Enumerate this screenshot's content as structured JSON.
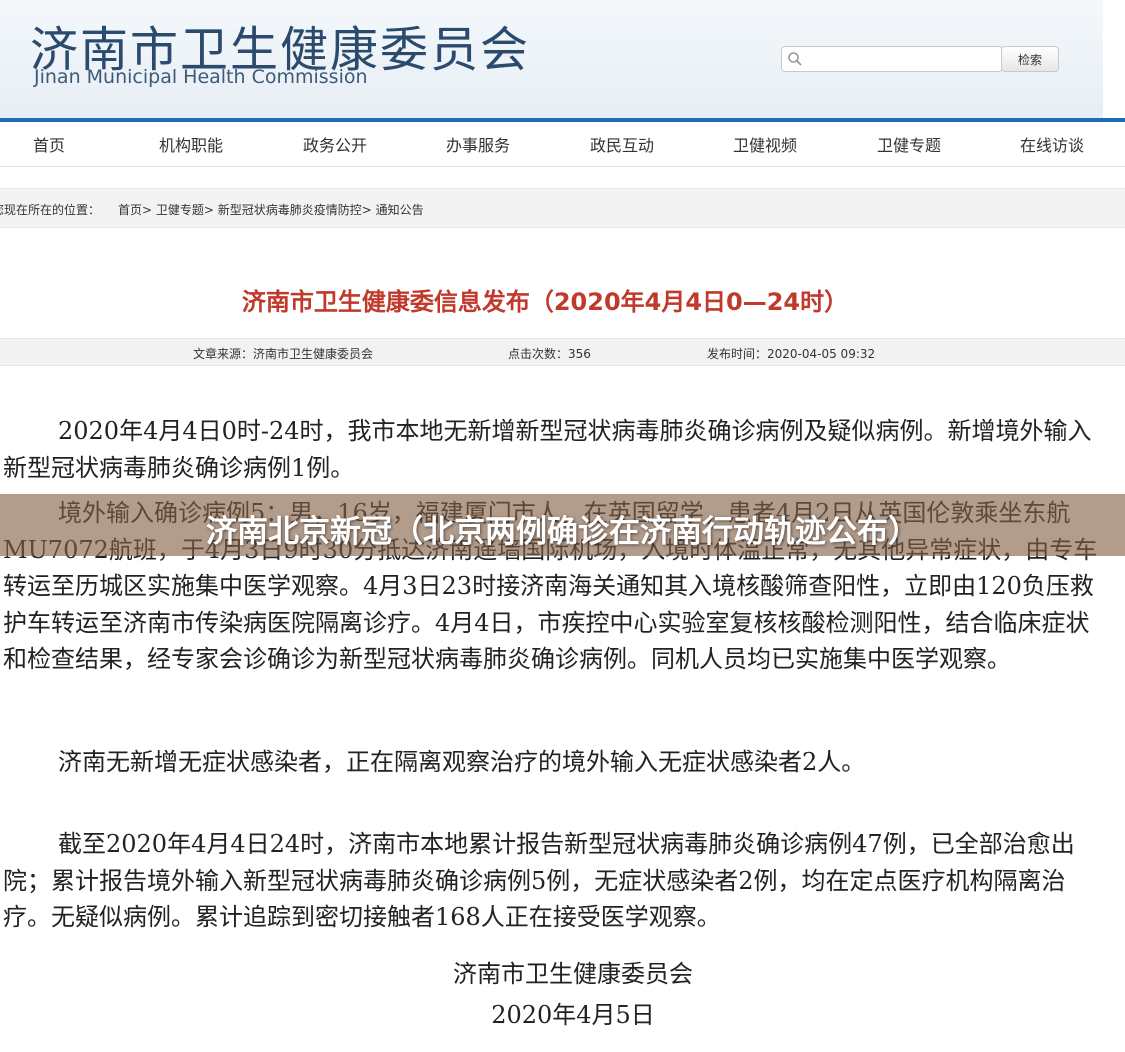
{
  "header": {
    "title_cn": "济南市卫生健康委员会",
    "title_en": "Jinan Municipal Health Commission",
    "search_button": "检索"
  },
  "nav": {
    "items": [
      "首页",
      "机构职能",
      "政务公开",
      "办事服务",
      "政民互动",
      "卫健视频",
      "卫健专题",
      "在线访谈"
    ]
  },
  "breadcrumb": {
    "prefix": "您现在所在的位置：",
    "path": "首页> 卫健专题> 新型冠状病毒肺炎疫情防控> 通知公告"
  },
  "article": {
    "title": "济南市卫生健康委信息发布（2020年4月4日0—24时）",
    "source": "文章来源：济南市卫生健康委员会",
    "clicks": "点击次数：356",
    "publish_time": "发布时间：2020-04-05 09:32",
    "paragraphs": [
      "2020年4月4日0时-24时，我市本地无新增新型冠状病毒肺炎确诊病例及疑似病例。新增境外输入新型冠状病毒肺炎确诊病例1例。",
      "境外输入确诊病例5：男，16岁，福建厦门市人，在英国留学，患者4月2日从英国伦敦乘坐东航MU7072航班，于4月3日9时30分抵达济南遥墙国际机场，入境时体温正常，无其他异常症状，由专车转运至历城区实施集中医学观察。4月3日23时接济南海关通知其入境核酸筛查阳性，立即由120负压救护车转运至济南市传染病医院隔离诊疗。4月4日，市疾控中心实验室复核核酸检测阳性，结合临床症状和检查结果，经专家会诊确诊为新型冠状病毒肺炎确诊病例。同机人员均已实施集中医学观察。",
      "济南无新增无症状感染者，正在隔离观察治疗的境外输入无症状感染者2人。",
      "截至2020年4月4日24时，济南市本地累计报告新型冠状病毒肺炎确诊病例47例，已全部治愈出院；累计报告境外输入新型冠状病毒肺炎确诊病例5例，无症状感染者2例，均在定点医疗机构隔离治疗。无疑似病例。累计追踪到密切接触者168人正在接受医学观察。"
    ],
    "signature": "济南市卫生健康委员会",
    "date": "2020年4月5日"
  },
  "overlay": {
    "text": "济南北京新冠（北京两例确诊在济南行动轨迹公布）"
  },
  "colors": {
    "nav_border": "#1f6cb5",
    "title_red": "#c0392b",
    "overlay": "#825f46"
  },
  "icons": {
    "search": "search-icon"
  }
}
